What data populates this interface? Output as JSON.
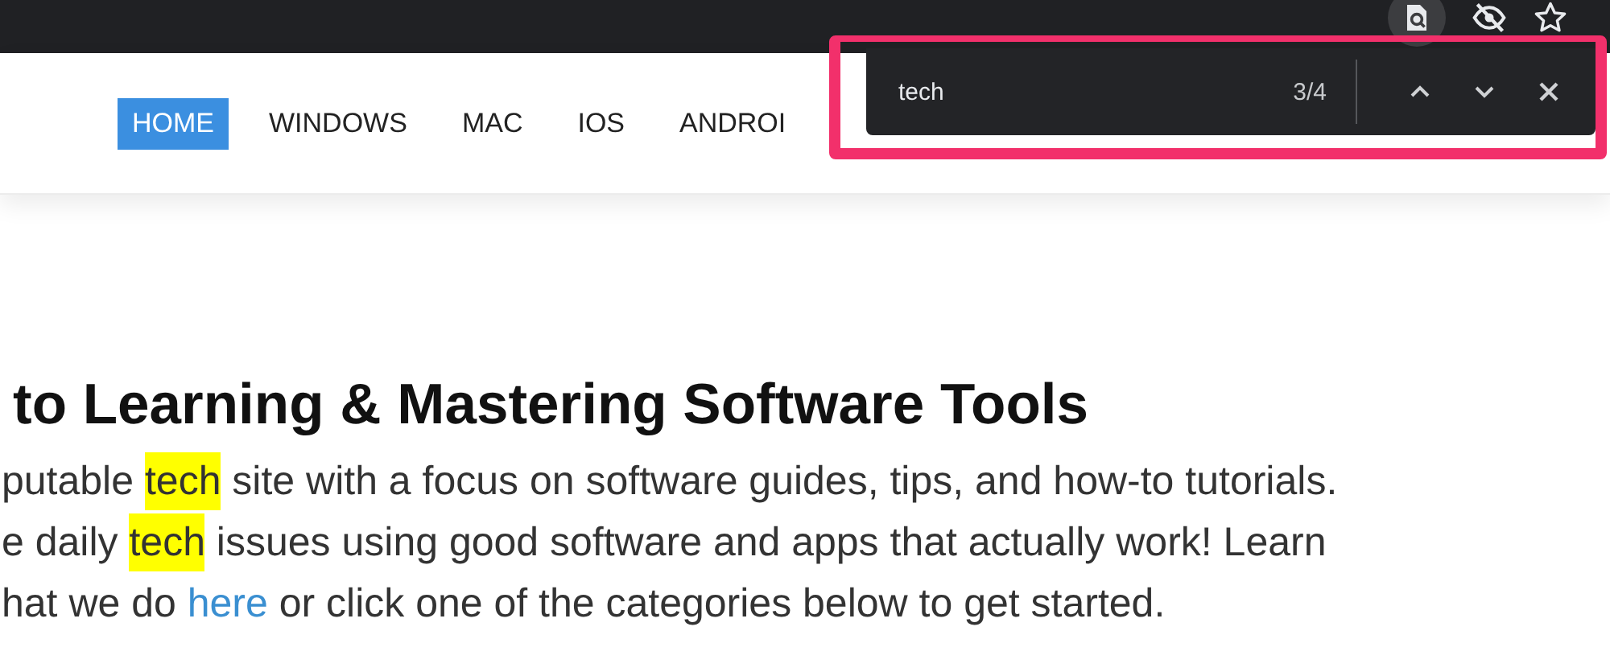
{
  "nav": [
    {
      "label": "HOME",
      "selected": true
    },
    {
      "label": "WINDOWS",
      "selected": false
    },
    {
      "label": "MAC",
      "selected": false
    },
    {
      "label": "IOS",
      "selected": false
    },
    {
      "label": "ANDROI",
      "selected": false
    }
  ],
  "find_bar": {
    "query": "tech",
    "count": "3/4"
  },
  "heading": "to Learning & Mastering Software Tools",
  "paragraph": [
    [
      {
        "text": "putable ",
        "highlight": false,
        "kind": "text"
      },
      {
        "text": "tech",
        "highlight": true,
        "kind": "text"
      },
      {
        "text": " site with a focus on software guides, tips, and how-to tutorials.",
        "highlight": false,
        "kind": "text"
      }
    ],
    [
      {
        "text": "e daily ",
        "highlight": false,
        "kind": "text"
      },
      {
        "text": "tech",
        "highlight": true,
        "kind": "text"
      },
      {
        "text": " issues using good software and apps that actually work! Learn",
        "highlight": false,
        "kind": "text"
      }
    ],
    [
      {
        "text": "hat we do ",
        "highlight": false,
        "kind": "text"
      },
      {
        "text": "here",
        "highlight": false,
        "kind": "link"
      },
      {
        "text": " or click one of the categories below to get started.",
        "highlight": false,
        "kind": "text"
      }
    ]
  ]
}
